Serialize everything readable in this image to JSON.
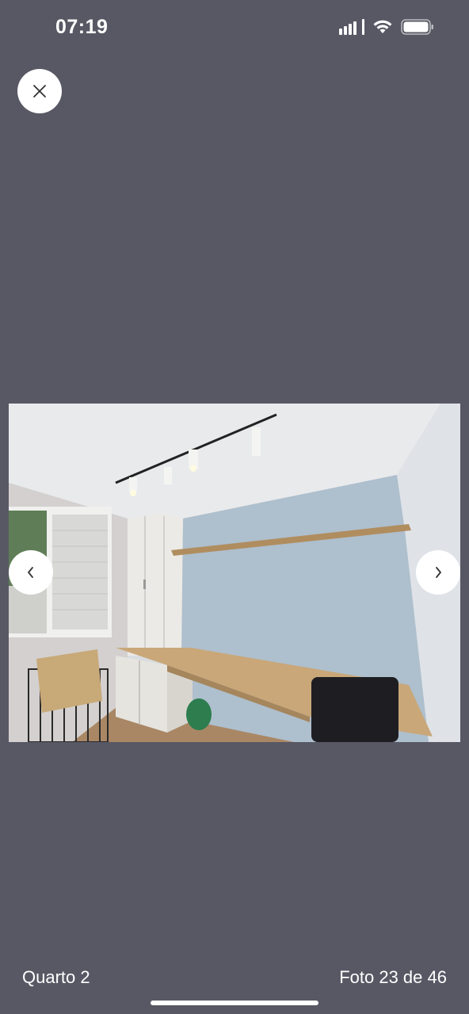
{
  "status_bar": {
    "time": "07:19",
    "icons": [
      "cellular-signal-icon",
      "wifi-icon",
      "battery-icon"
    ]
  },
  "viewer": {
    "close_icon": "close-icon",
    "prev_icon": "chevron-left-icon",
    "next_icon": "chevron-right-icon",
    "caption": "Quarto 2",
    "counter": "Foto 23 de 46"
  },
  "colors": {
    "background": "#585865",
    "button_bg": "#ffffff",
    "text": "#ffffff"
  }
}
